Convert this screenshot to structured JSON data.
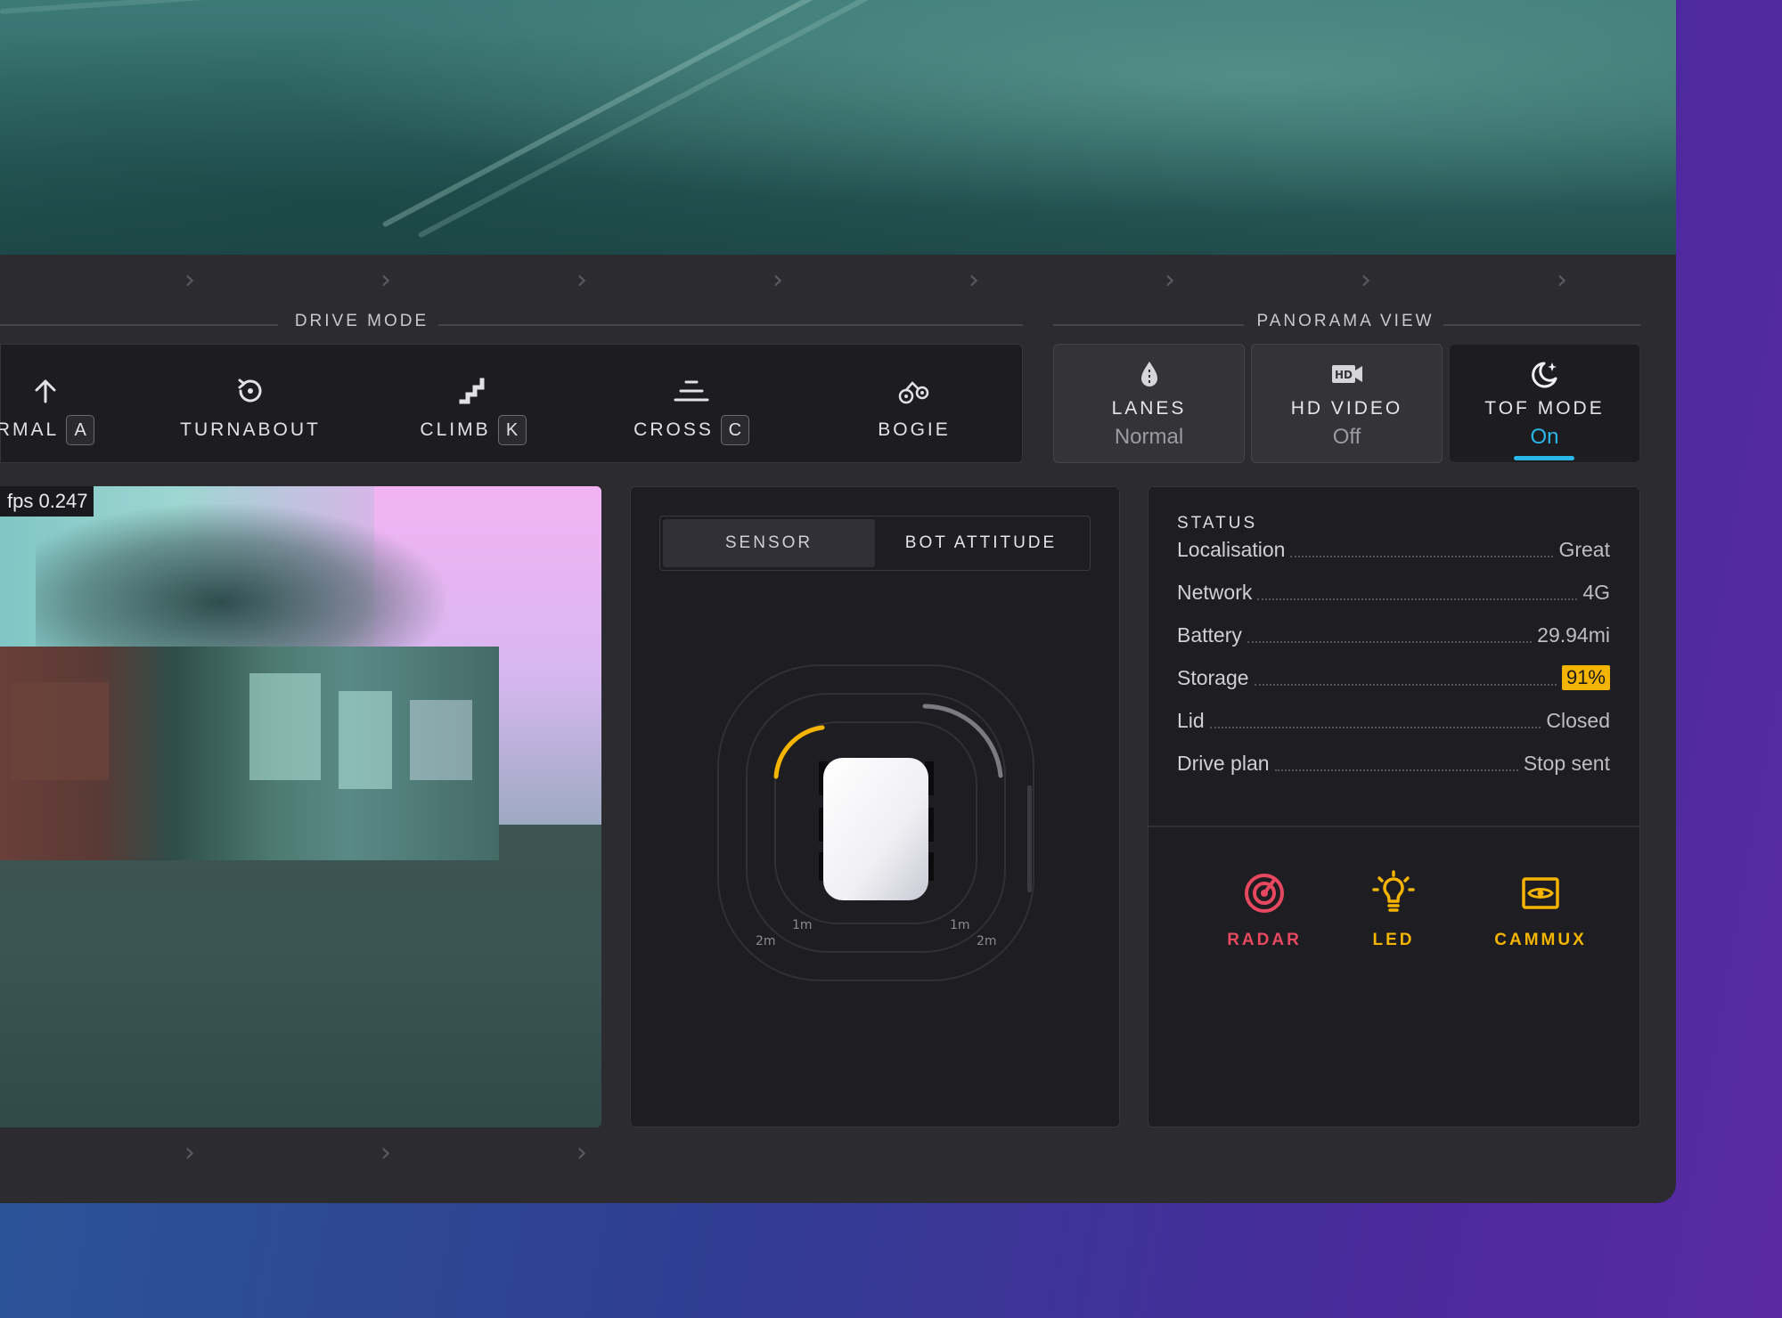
{
  "drive_mode": {
    "title": "DRIVE MODE",
    "items": [
      {
        "label": "RMAL",
        "key": "A",
        "icon": "arrow-up-icon"
      },
      {
        "label": "TURNABOUT",
        "key": "",
        "icon": "rotate-icon"
      },
      {
        "label": "CLIMB",
        "key": "K",
        "icon": "stairs-icon"
      },
      {
        "label": "CROSS",
        "key": "C",
        "icon": "cross-lines-icon"
      },
      {
        "label": "BOGIE",
        "key": "",
        "icon": "bogie-icon"
      }
    ]
  },
  "panorama_view": {
    "title": "PANORAMA VIEW",
    "buttons": [
      {
        "label": "LANES",
        "value": "Normal",
        "icon": "drop-icon",
        "active": false
      },
      {
        "label": "HD VIDEO",
        "value": "Off",
        "icon": "hd-video-icon",
        "active": false
      },
      {
        "label": "TOF MODE",
        "value": "On",
        "icon": "moon-star-icon",
        "active": true
      }
    ]
  },
  "camera": {
    "fps_label": "fps 0.247"
  },
  "sensor_panel": {
    "tabs": [
      {
        "label": "SENSOR",
        "active": true
      },
      {
        "label": "BOT ATTITUDE",
        "active": false
      }
    ],
    "ring_labels": {
      "inner_left": "1m",
      "inner_right": "1m",
      "outer_left": "2m",
      "outer_right": "2m"
    }
  },
  "status": {
    "title": "STATUS",
    "rows": [
      {
        "key": "Localisation",
        "value": "Great",
        "highlight": false
      },
      {
        "key": "Network",
        "value": "4G",
        "highlight": false
      },
      {
        "key": "Battery",
        "value": "29.94mi",
        "highlight": false
      },
      {
        "key": "Storage",
        "value": "91%",
        "highlight": true
      },
      {
        "key": "Lid",
        "value": "Closed",
        "highlight": false
      },
      {
        "key": "Drive plan",
        "value": "Stop sent",
        "highlight": false
      }
    ],
    "tools": [
      {
        "label": "RADAR",
        "icon": "radar-icon",
        "color": "#e8485f"
      },
      {
        "label": "LED",
        "icon": "lightbulb-icon",
        "color": "#f4b400"
      },
      {
        "label": "CAMMUX",
        "icon": "camera-eye-icon",
        "color": "#f4b400"
      }
    ]
  },
  "colors": {
    "accent": "#29b6e8",
    "highlight": "#f4b400",
    "radar": "#e8485f",
    "arc": "#f4b400"
  }
}
